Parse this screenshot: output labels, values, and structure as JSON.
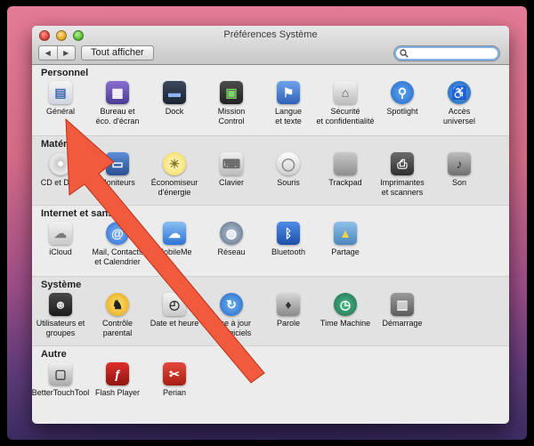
{
  "window": {
    "title": "Préférences Système",
    "nav_back": "◀",
    "nav_forward": "▶",
    "show_all": "Tout afficher",
    "search_placeholder": "",
    "search_value": ""
  },
  "sections": [
    {
      "title": "Personnel",
      "items": [
        {
          "label": "Général",
          "icon": "general-icon"
        },
        {
          "label": "Bureau et\néco. d'écran",
          "icon": "desktop-screensaver-icon"
        },
        {
          "label": "Dock",
          "icon": "dock-icon"
        },
        {
          "label": "Mission\nControl",
          "icon": "mission-control-icon"
        },
        {
          "label": "Langue\net texte",
          "icon": "language-text-icon"
        },
        {
          "label": "Sécurité\net confidentialité",
          "icon": "security-privacy-icon"
        },
        {
          "label": "Spotlight",
          "icon": "spotlight-icon"
        },
        {
          "label": "Accès\nuniversel",
          "icon": "universal-access-icon"
        }
      ]
    },
    {
      "title": "Matériel",
      "items": [
        {
          "label": "CD et DVD",
          "icon": "cd-dvd-icon"
        },
        {
          "label": "Moniteurs",
          "icon": "displays-icon"
        },
        {
          "label": "Économiseur\nd'énergie",
          "icon": "energy-saver-icon"
        },
        {
          "label": "Clavier",
          "icon": "keyboard-icon"
        },
        {
          "label": "Souris",
          "icon": "mouse-icon"
        },
        {
          "label": "Trackpad",
          "icon": "trackpad-icon"
        },
        {
          "label": "Imprimantes\net scanners",
          "icon": "printer-icon"
        },
        {
          "label": "Son",
          "icon": "sound-icon"
        }
      ]
    },
    {
      "title": "Internet et sans fil",
      "items": [
        {
          "label": "iCloud",
          "icon": "icloud-icon"
        },
        {
          "label": "Mail, Contacts\net Calendrier",
          "icon": "mail-contacts-icon"
        },
        {
          "label": "MobileMe",
          "icon": "mobileme-icon"
        },
        {
          "label": "Réseau",
          "icon": "network-icon"
        },
        {
          "label": "Bluetooth",
          "icon": "bluetooth-icon"
        },
        {
          "label": "Partage",
          "icon": "sharing-icon"
        }
      ]
    },
    {
      "title": "Système",
      "items": [
        {
          "label": "Utilisateurs et\ngroupes",
          "icon": "users-groups-icon"
        },
        {
          "label": "Contrôle\nparental",
          "icon": "parental-controls-icon"
        },
        {
          "label": "Date et heure",
          "icon": "date-time-icon"
        },
        {
          "label": "Mise à jour\nde logiciels",
          "icon": "software-update-icon"
        },
        {
          "label": "Parole",
          "icon": "speech-icon"
        },
        {
          "label": "Time Machine",
          "icon": "time-machine-icon"
        },
        {
          "label": "Démarrage",
          "icon": "startup-disk-icon"
        }
      ]
    },
    {
      "title": "Autre",
      "items": [
        {
          "label": "BetterTouchTool",
          "icon": "bettertouchtool-icon"
        },
        {
          "label": "Flash Player",
          "icon": "flash-player-icon"
        },
        {
          "label": "Perian",
          "icon": "perian-icon"
        }
      ]
    }
  ],
  "colors": {
    "arrow": "#f15a3c",
    "accent": "#3d7dd8"
  }
}
